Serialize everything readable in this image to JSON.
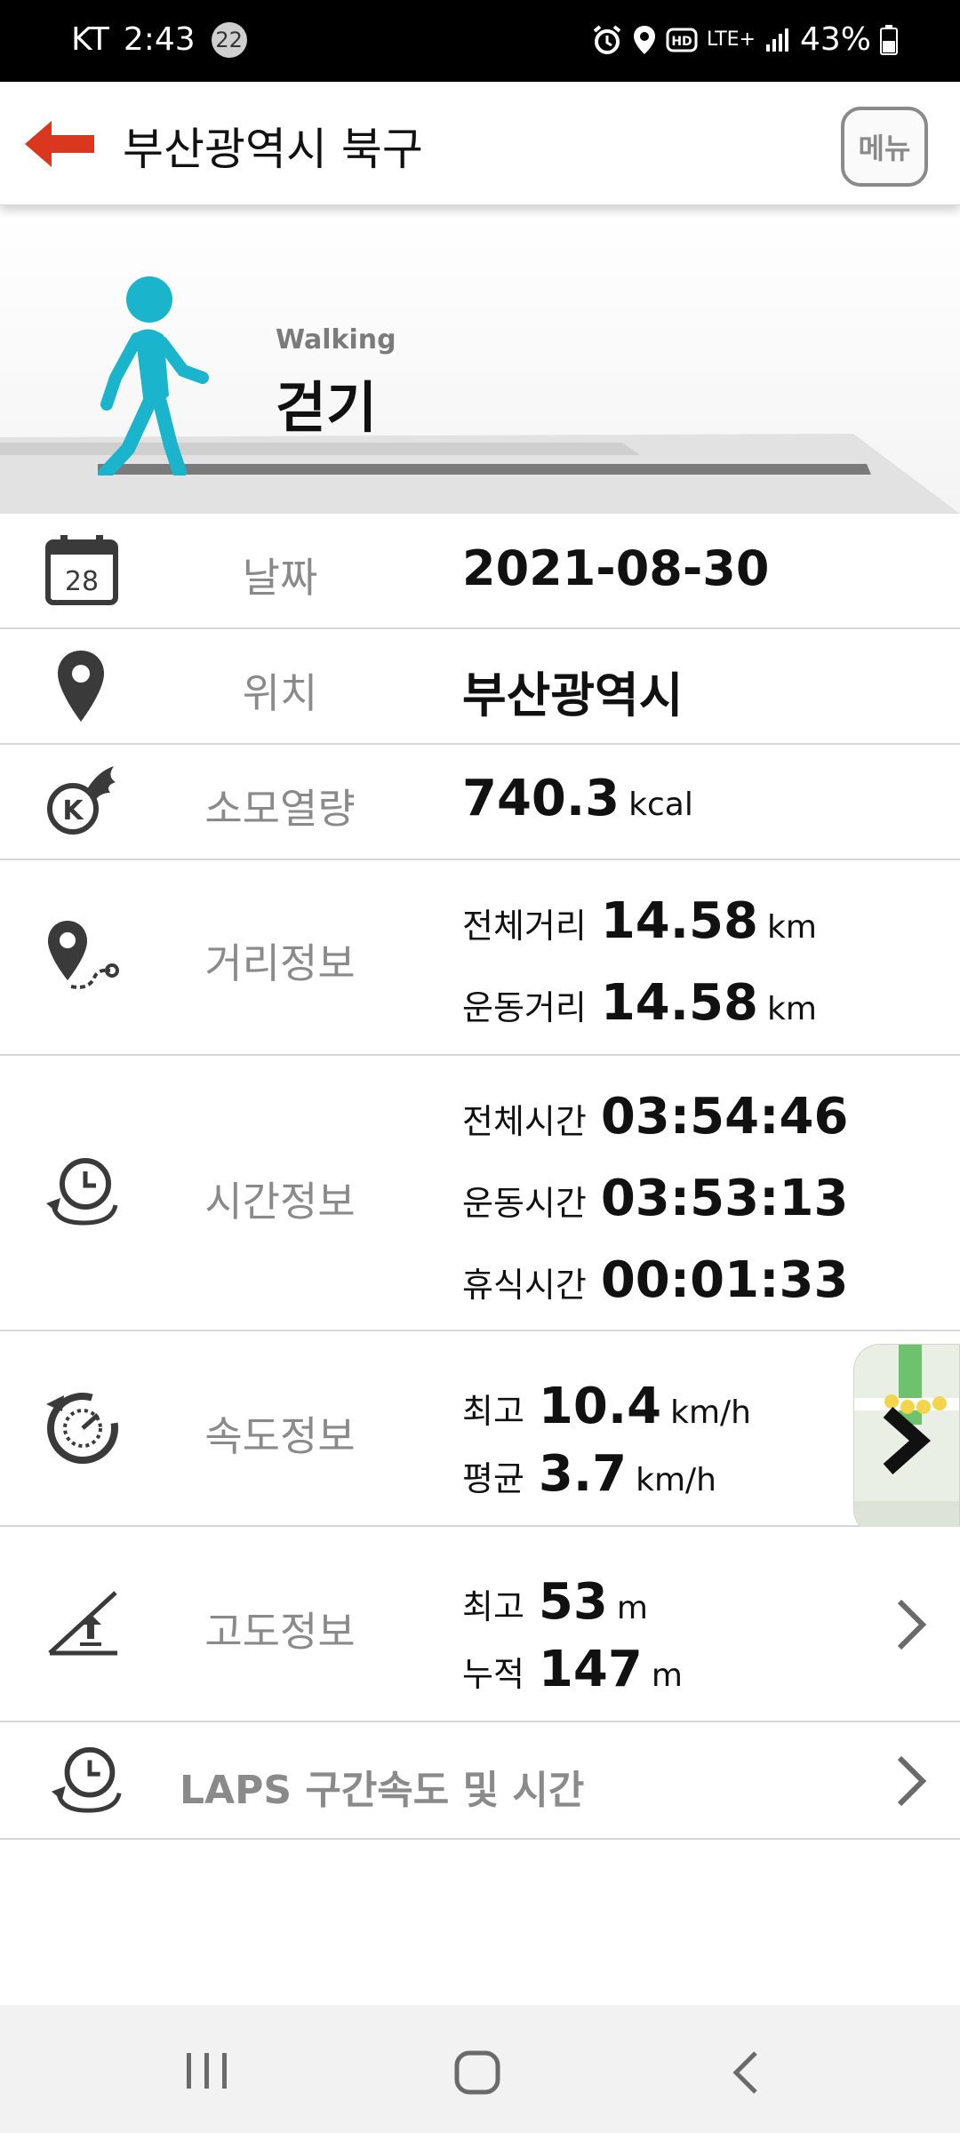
{
  "status_bar": {
    "carrier": "KT",
    "time": "2:43",
    "badge": "22",
    "network": "LTE+",
    "battery": "43%"
  },
  "header": {
    "title": "부산광역시 북구",
    "menu_label": "메뉴"
  },
  "activity": {
    "en": "Walking",
    "ko": "걷기",
    "color": "#1ab5cc"
  },
  "rows": {
    "date": {
      "label": "날짜",
      "value": "2021-08-30",
      "icon_day": "28"
    },
    "location": {
      "label": "위치",
      "value": "부산광역시"
    },
    "calories": {
      "label": "소모열량",
      "value": "740.3",
      "unit": "kcal"
    },
    "distance": {
      "label": "거리정보",
      "total_label": "전체거리",
      "total_value": "14.58",
      "total_unit": "km",
      "moving_label": "운동거리",
      "moving_value": "14.58",
      "moving_unit": "km"
    },
    "time": {
      "label": "시간정보",
      "total_label": "전체시간",
      "total_value": "03:54:46",
      "moving_label": "운동시간",
      "moving_value": "03:53:13",
      "rest_label": "휴식시간",
      "rest_value": "00:01:33"
    },
    "speed": {
      "label": "속도정보",
      "max_label": "최고",
      "max_value": "10.4",
      "max_unit": "km/h",
      "avg_label": "평균",
      "avg_value": "3.7",
      "avg_unit": "km/h"
    },
    "altitude": {
      "label": "고도정보",
      "max_label": "최고",
      "max_value": "53",
      "max_unit": "m",
      "cum_label": "누적",
      "cum_value": "147",
      "cum_unit": "m"
    },
    "laps": {
      "label": "LAPS 구간속도 및 시간"
    }
  },
  "colors": {
    "back_arrow": "#d9381e",
    "icon": "#3a3a3a",
    "label": "#8a8a8a"
  }
}
